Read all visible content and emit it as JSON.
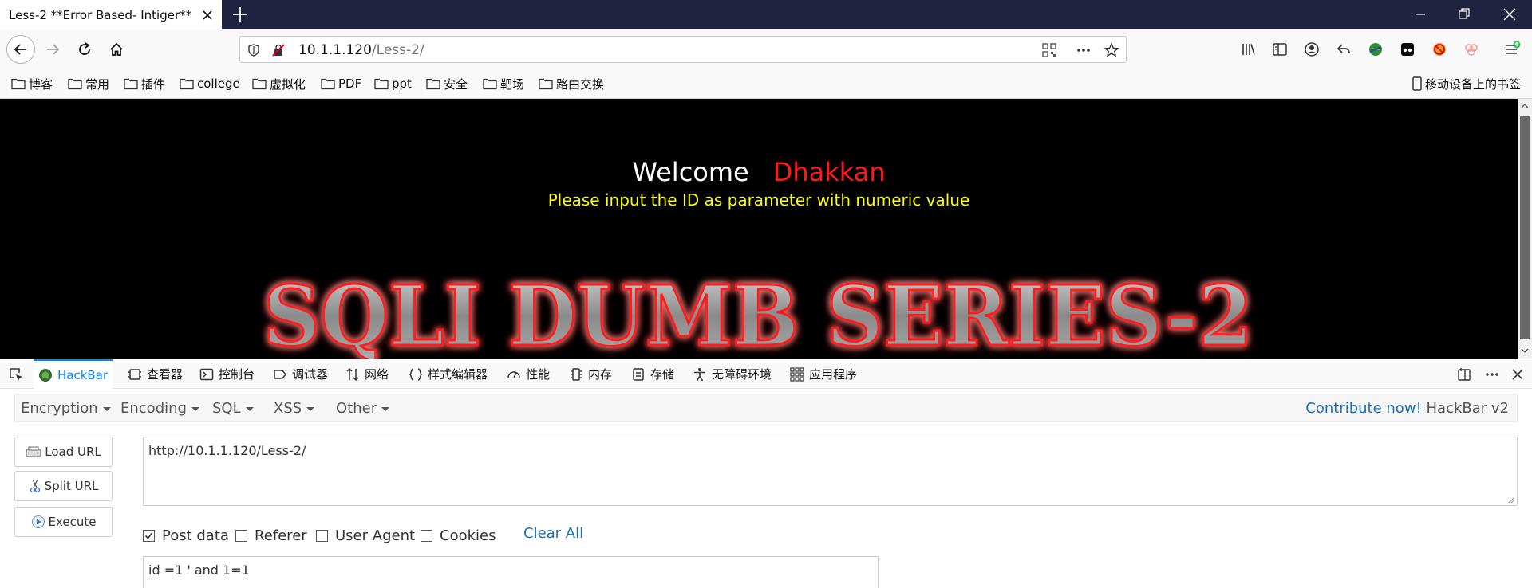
{
  "tab": {
    "title": "Less-2 **Error Based- Intiger**"
  },
  "urlbar": {
    "host": "10.1.1.120",
    "path": "/Less-2/"
  },
  "bookmarks": [
    {
      "label": "博客"
    },
    {
      "label": "常用"
    },
    {
      "label": "插件"
    },
    {
      "label": "college"
    },
    {
      "label": "虚拟化"
    },
    {
      "label": "PDF"
    },
    {
      "label": "ppt"
    },
    {
      "label": "安全"
    },
    {
      "label": "靶场"
    },
    {
      "label": "路由交换"
    }
  ],
  "mobile_bookmarks": "移动设备上的书签",
  "page": {
    "welcome_word": "Welcome",
    "welcome_name": "Dhakkan",
    "instruction": "Please input the ID as parameter with numeric value",
    "banner_text": "SQLI DUMB SERIES-2"
  },
  "devtools": {
    "tabs": [
      {
        "label": "HackBar",
        "icon": "hackbar-icon",
        "active": true
      },
      {
        "label": "查看器",
        "icon": "inspector-icon"
      },
      {
        "label": "控制台",
        "icon": "console-icon"
      },
      {
        "label": "调试器",
        "icon": "debugger-icon"
      },
      {
        "label": "网络",
        "icon": "network-icon"
      },
      {
        "label": "样式编辑器",
        "icon": "style-editor-icon"
      },
      {
        "label": "性能",
        "icon": "performance-icon"
      },
      {
        "label": "内存",
        "icon": "memory-icon"
      },
      {
        "label": "存储",
        "icon": "storage-icon"
      },
      {
        "label": "无障碍环境",
        "icon": "accessibility-icon"
      },
      {
        "label": "应用程序",
        "icon": "application-icon"
      }
    ]
  },
  "hackbar": {
    "menus": [
      "Encryption",
      "Encoding",
      "SQL",
      "XSS",
      "Other"
    ],
    "contribute_link": "Contribute now!",
    "version": "HackBar v2",
    "buttons": {
      "load": "Load URL",
      "split": "Split URL",
      "execute": "Execute"
    },
    "url_value": "http://10.1.1.120/Less-2/",
    "options": [
      {
        "label": "Post data",
        "checked": true
      },
      {
        "label": "Referer",
        "checked": false
      },
      {
        "label": "User Agent",
        "checked": false
      },
      {
        "label": "Cookies",
        "checked": false
      }
    ],
    "clear_all": "Clear All",
    "post_value": "id =1 ' and 1=1"
  }
}
